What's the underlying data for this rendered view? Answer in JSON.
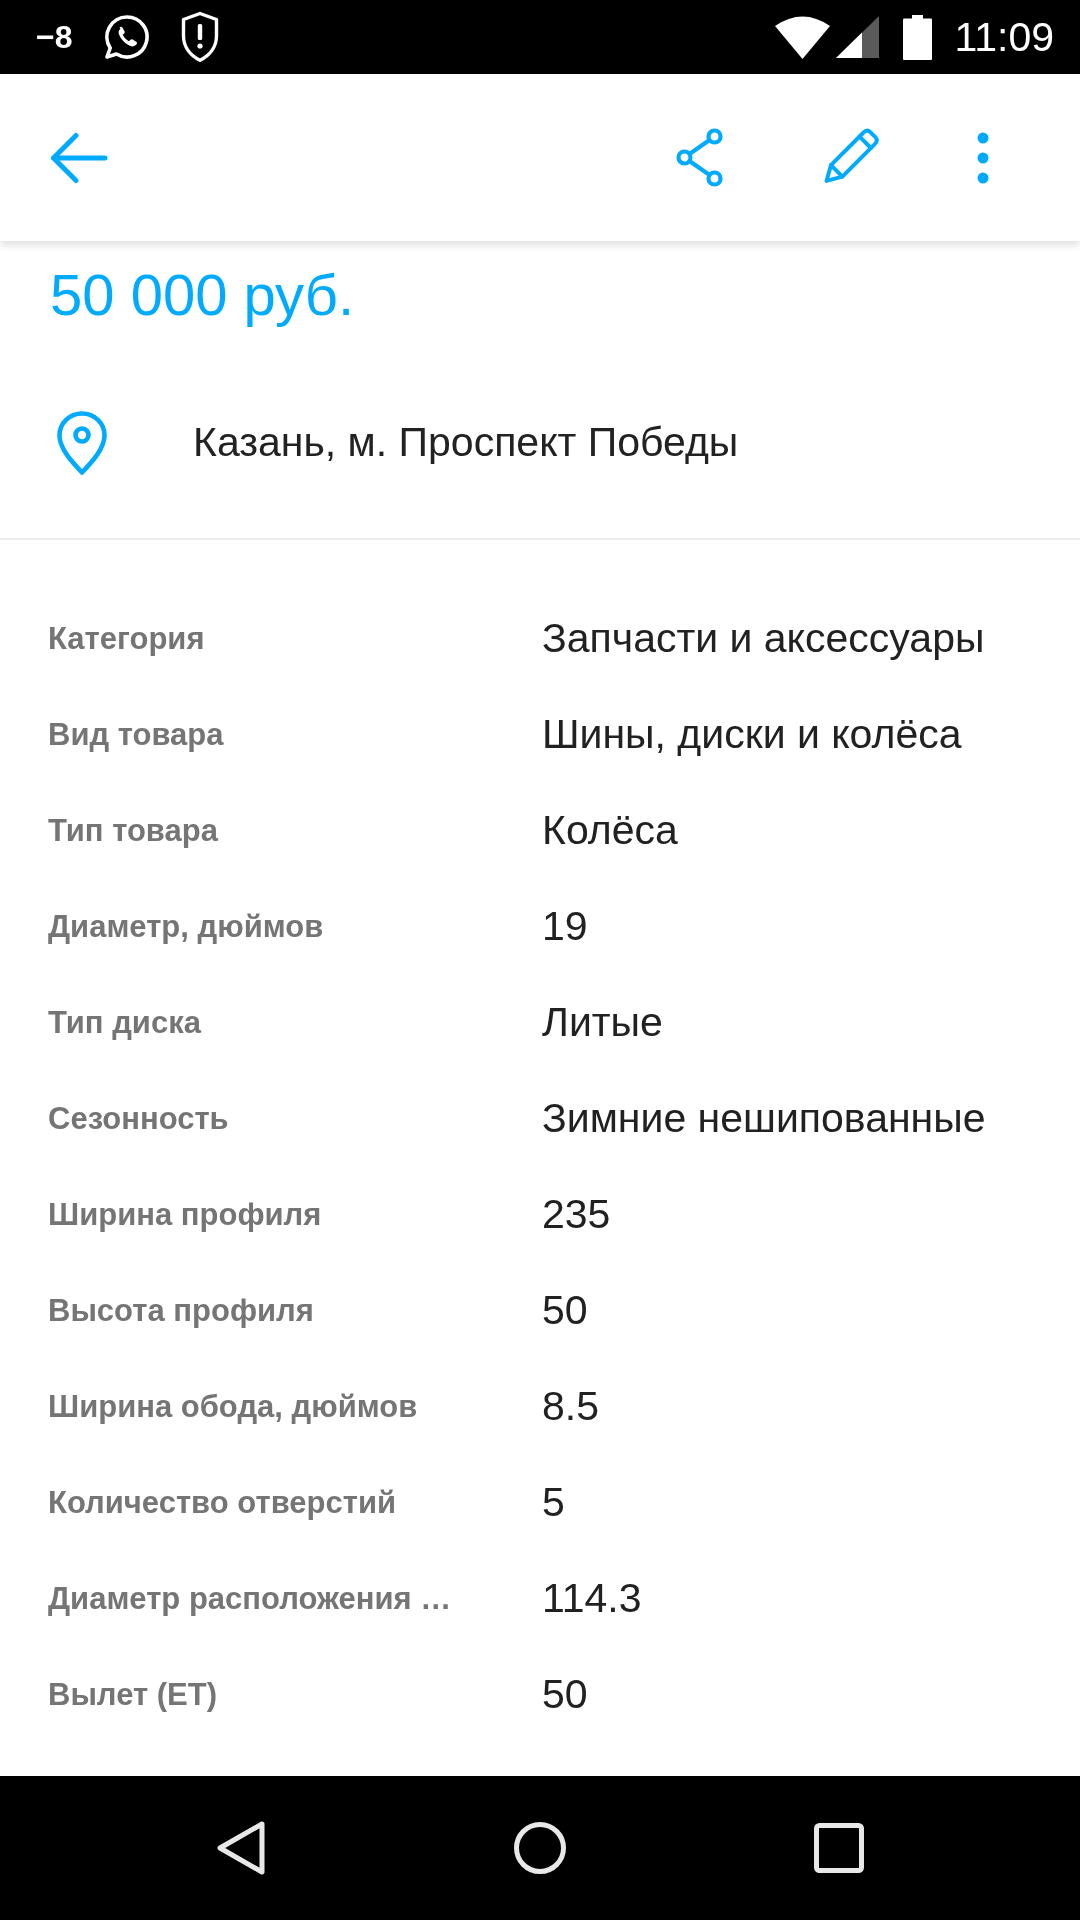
{
  "status_bar": {
    "notification": "−8",
    "time": "11:09"
  },
  "listing": {
    "price": "50 000 руб.",
    "location": "Казань, м. Проспект Победы"
  },
  "details": [
    {
      "label": "Категория",
      "value": "Запчасти и аксессуары"
    },
    {
      "label": "Вид товара",
      "value": "Шины, диски и колёса"
    },
    {
      "label": "Тип товара",
      "value": "Колёса"
    },
    {
      "label": "Диаметр, дюймов",
      "value": "19"
    },
    {
      "label": "Тип диска",
      "value": "Литые"
    },
    {
      "label": "Сезонность",
      "value": "Зимние нешипованные"
    },
    {
      "label": "Ширина профиля",
      "value": "235"
    },
    {
      "label": "Высота профиля",
      "value": "50"
    },
    {
      "label": "Ширина обода, дюймов",
      "value": "8.5"
    },
    {
      "label": "Количество отверстий",
      "value": "5"
    },
    {
      "label": "Диаметр расположения …",
      "value": "114.3"
    },
    {
      "label": "Вылет (ET)",
      "value": "50"
    }
  ]
}
